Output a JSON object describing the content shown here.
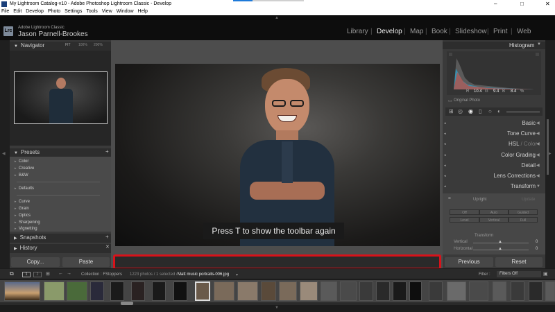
{
  "window": {
    "title": "My Lightroom Catalog-v10 - Adobe Photoshop Lightroom Classic - Develop",
    "min": "–",
    "max": "□",
    "close": "✕"
  },
  "menu": [
    "File",
    "Edit",
    "Develop",
    "Photo",
    "Settings",
    "Tools",
    "View",
    "Window",
    "Help"
  ],
  "identity": {
    "logo": "Lrc",
    "product": "Adobe Lightroom Classic",
    "user": "Jason Parnell-Brookes"
  },
  "modules": [
    "Library",
    "Develop",
    "Map",
    "Book",
    "Slideshow",
    "Print",
    "Web"
  ],
  "module_sep": "|",
  "navigator": {
    "title": "Navigator",
    "fit": "FIT",
    "zoom1": "100%",
    "zoom2": "200%"
  },
  "presets": {
    "title": "Presets",
    "add": "+",
    "group1": [
      "Color",
      "Creative",
      "B&W"
    ],
    "group2": [
      "Defaults"
    ],
    "group3": [
      "Curve",
      "Grain",
      "Optics",
      "Sharpening",
      "Vignetting"
    ]
  },
  "snapshots": {
    "title": "Snapshots",
    "add": "+"
  },
  "history": {
    "title": "History",
    "clear": "✕"
  },
  "left_buttons": {
    "copy": "Copy...",
    "paste": "Paste"
  },
  "overlay": {
    "message": "Press T to show the toolbar again"
  },
  "histogram": {
    "title": "Histogram",
    "r_label": "R",
    "r_value": "10.4",
    "g_label": "G",
    "g_value": "9.4",
    "b_label": "B",
    "b_value": "8.4",
    "pct": "%",
    "original": "Original Photo"
  },
  "right_sections": [
    "Basic",
    "Tone Curve",
    "HSL",
    "Color Grading",
    "Detail",
    "Lens Corrections",
    "Transform"
  ],
  "hsl_secondary": " / Color",
  "transform": {
    "upright_label": "Upright",
    "update": "Update",
    "buttons_row1": [
      "Off",
      "Auto",
      "Guided"
    ],
    "buttons_row2": [
      "Level",
      "Vertical",
      "Full"
    ],
    "transform_label": "Transform",
    "vertical_label": "Vertical",
    "vertical_value": "0",
    "horizontal_label": "Horizontal",
    "horizontal_value": "0"
  },
  "right_buttons": {
    "previous": "Previous",
    "reset": "Reset"
  },
  "filmstrip": {
    "page1": "1",
    "page2": "2",
    "collection": "Collection : FStoppers",
    "count": "1223 photos / 1 selected /",
    "filename": "Matt music portraits-006.jpg",
    "filter_label": "Filter :",
    "filter_value": "Filters Off"
  },
  "colors": {
    "highlight": "#d8121a",
    "accent": "#e6e6e6",
    "panel": "#3a3a3a"
  }
}
